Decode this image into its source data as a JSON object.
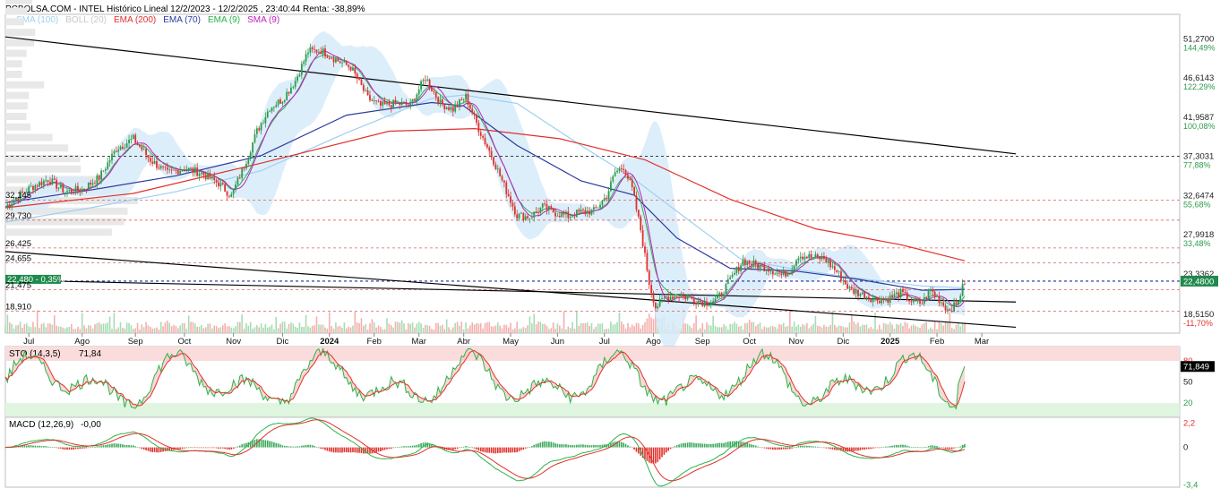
{
  "header": {
    "title": "PCBOLSA.COM - INTEL Histórico Lineal 12/2/2023 - 12/2/2025 , 23:40:44 Renta: -38,89%",
    "legend": [
      {
        "label": "SMA (100)",
        "color": "#9ed1f0"
      },
      {
        "label": "BOLL (20)",
        "color": "#c8c8c8"
      },
      {
        "label": "EMA (200)",
        "color": "#e0312c"
      },
      {
        "label": "EMA (70)",
        "color": "#2a3b9c"
      },
      {
        "label": "EMA (9)",
        "color": "#2bb34a"
      },
      {
        "label": "SMA (9)",
        "color": "#c020c0"
      }
    ]
  },
  "colors": {
    "up": "#2e9b4c",
    "down": "#e0312c",
    "current": "#1f8a4c"
  },
  "chart_data": [
    {
      "type": "candlestick",
      "x_ticks": [
        "Jul",
        "Ago",
        "Sep",
        "Oct",
        "Nov",
        "Dic",
        "2024",
        "Feb",
        "Mar",
        "Abr",
        "May",
        "Jun",
        "Jul",
        "Ago",
        "Sep",
        "Oct",
        "Nov",
        "Dic",
        "2025",
        "Feb",
        "Mar"
      ],
      "x_tick_idx": [
        11,
        36,
        61,
        84,
        107,
        130,
        152,
        173,
        194,
        215,
        237,
        259,
        281,
        304,
        327,
        349,
        371,
        393,
        415,
        437,
        458
      ],
      "y_axis": [
        {
          "value": "51,2700",
          "pct": "144,49%"
        },
        {
          "value": "46,6143",
          "pct": "122,29%"
        },
        {
          "value": "41,9587",
          "pct": "100,08%"
        },
        {
          "value": "37,3031",
          "pct": "77,88%"
        },
        {
          "value": "32,6474",
          "pct": "55,68%"
        },
        {
          "value": "27,9918",
          "pct": "33,48%"
        },
        {
          "value": "23,3362",
          "pct": ""
        },
        {
          "value": "18,5150",
          "pct": "-11,70%"
        }
      ],
      "ylim": [
        16.3,
        52.8
      ],
      "levels_left": [
        "32,145",
        "29,730",
        "26,425",
        "24,655",
        "22,480 - 0,35%",
        "21,475",
        "18,910"
      ],
      "current_price": "22,4800",
      "anchors": [
        [
          0,
          31.3
        ],
        [
          5,
          32.4
        ],
        [
          12,
          33.6
        ],
        [
          20,
          34.6
        ],
        [
          28,
          33.1
        ],
        [
          36,
          33.4
        ],
        [
          44,
          34.8
        ],
        [
          52,
          38.2
        ],
        [
          60,
          39.4
        ],
        [
          68,
          36.9
        ],
        [
          76,
          35.3
        ],
        [
          84,
          35.9
        ],
        [
          92,
          35.3
        ],
        [
          100,
          34.1
        ],
        [
          106,
          32.6
        ],
        [
          112,
          36.2
        ],
        [
          118,
          40.3
        ],
        [
          124,
          43.1
        ],
        [
          130,
          44.1
        ],
        [
          136,
          46.3
        ],
        [
          142,
          49.8
        ],
        [
          148,
          49.9
        ],
        [
          155,
          48.8
        ],
        [
          162,
          47.9
        ],
        [
          170,
          44.2
        ],
        [
          176,
          43.3
        ],
        [
          183,
          43.6
        ],
        [
          190,
          43.4
        ],
        [
          197,
          46.7
        ],
        [
          204,
          43.6
        ],
        [
          210,
          42.9
        ],
        [
          216,
          44.4
        ],
        [
          222,
          40.6
        ],
        [
          228,
          37.4
        ],
        [
          234,
          33.8
        ],
        [
          240,
          30.3
        ],
        [
          246,
          30.1
        ],
        [
          252,
          31.3
        ],
        [
          258,
          30.6
        ],
        [
          264,
          30.2
        ],
        [
          270,
          30.7
        ],
        [
          276,
          30.8
        ],
        [
          282,
          32.6
        ],
        [
          286,
          35.4
        ],
        [
          290,
          36.1
        ],
        [
          294,
          33.4
        ],
        [
          298,
          28.6
        ],
        [
          302,
          22.3
        ],
        [
          305,
          19.4
        ],
        [
          310,
          20.6
        ],
        [
          316,
          20.8
        ],
        [
          322,
          20.4
        ],
        [
          328,
          19.9
        ],
        [
          334,
          20.3
        ],
        [
          340,
          22.6
        ],
        [
          346,
          24.9
        ],
        [
          352,
          24.4
        ],
        [
          358,
          24.0
        ],
        [
          364,
          23.2
        ],
        [
          368,
          23.7
        ],
        [
          372,
          25.6
        ],
        [
          378,
          25.3
        ],
        [
          384,
          25.2
        ],
        [
          390,
          23.6
        ],
        [
          396,
          21.5
        ],
        [
          402,
          20.9
        ],
        [
          408,
          20.3
        ],
        [
          414,
          20.4
        ],
        [
          420,
          21.1
        ],
        [
          426,
          19.9
        ],
        [
          430,
          19.9
        ],
        [
          434,
          21.4
        ],
        [
          438,
          20.3
        ],
        [
          442,
          19.1
        ],
        [
          446,
          19.6
        ],
        [
          450,
          22.4
        ]
      ],
      "ema200": [
        [
          0,
          31.2
        ],
        [
          60,
          32.9
        ],
        [
          120,
          36.5
        ],
        [
          180,
          40.3
        ],
        [
          220,
          40.6
        ],
        [
          260,
          39.4
        ],
        [
          300,
          36.9
        ],
        [
          340,
          32.2
        ],
        [
          380,
          28.7
        ],
        [
          420,
          26.8
        ],
        [
          450,
          24.9
        ]
      ],
      "ema70": [
        [
          0,
          31.8
        ],
        [
          40,
          33.3
        ],
        [
          80,
          35.0
        ],
        [
          120,
          37.4
        ],
        [
          160,
          42.2
        ],
        [
          200,
          43.7
        ],
        [
          215,
          43.3
        ],
        [
          240,
          38.6
        ],
        [
          270,
          34.4
        ],
        [
          295,
          32.7
        ],
        [
          315,
          27.6
        ],
        [
          340,
          24.0
        ],
        [
          370,
          23.7
        ],
        [
          400,
          22.7
        ],
        [
          430,
          21.4
        ],
        [
          450,
          21.5
        ]
      ],
      "sma100": [
        [
          0,
          29.5
        ],
        [
          40,
          31.2
        ],
        [
          80,
          33.1
        ],
        [
          120,
          35.6
        ],
        [
          160,
          40.1
        ],
        [
          200,
          44.2
        ],
        [
          215,
          44.6
        ],
        [
          240,
          43.6
        ],
        [
          270,
          38.6
        ],
        [
          295,
          34.6
        ],
        [
          318,
          30.2
        ],
        [
          345,
          25.1
        ],
        [
          370,
          23.9
        ],
        [
          400,
          22.8
        ],
        [
          430,
          21.9
        ],
        [
          450,
          21.7
        ]
      ],
      "trend_lines": [
        {
          "x0": 0,
          "y0": 51.5,
          "x1": 474,
          "y1": 37.6
        },
        {
          "x0": 0,
          "y0": 26.0,
          "x1": 474,
          "y1": 17.0
        },
        {
          "x0": 0,
          "y0": 22.6,
          "x1": 474,
          "y1": 20.0
        }
      ],
      "h_levels": [
        {
          "y": 37.3,
          "color": "#000000"
        },
        {
          "y": 32.1,
          "color": "#e06060"
        },
        {
          "y": 29.73,
          "color": "#e06060"
        },
        {
          "y": 26.425,
          "color": "#e06060"
        },
        {
          "y": 24.655,
          "color": "#e06060"
        },
        {
          "y": 22.48,
          "color": "#1c2b9c"
        },
        {
          "y": 21.475,
          "color": "#e06060"
        },
        {
          "y": 18.91,
          "color": "#e06060"
        }
      ]
    },
    {
      "type": "line",
      "name": "STO (14,3,5)",
      "value": "71,84",
      "value_box": "71,849",
      "y_ticks": [
        "80",
        "50",
        "20"
      ],
      "ylim": [
        0,
        100
      ]
    },
    {
      "type": "bar",
      "name": "MACD (12,26,9)",
      "value": "-0,00",
      "y_ticks": [
        "2,2",
        "0",
        "-3,4"
      ],
      "ylim": [
        -3.6,
        2.4
      ]
    }
  ]
}
